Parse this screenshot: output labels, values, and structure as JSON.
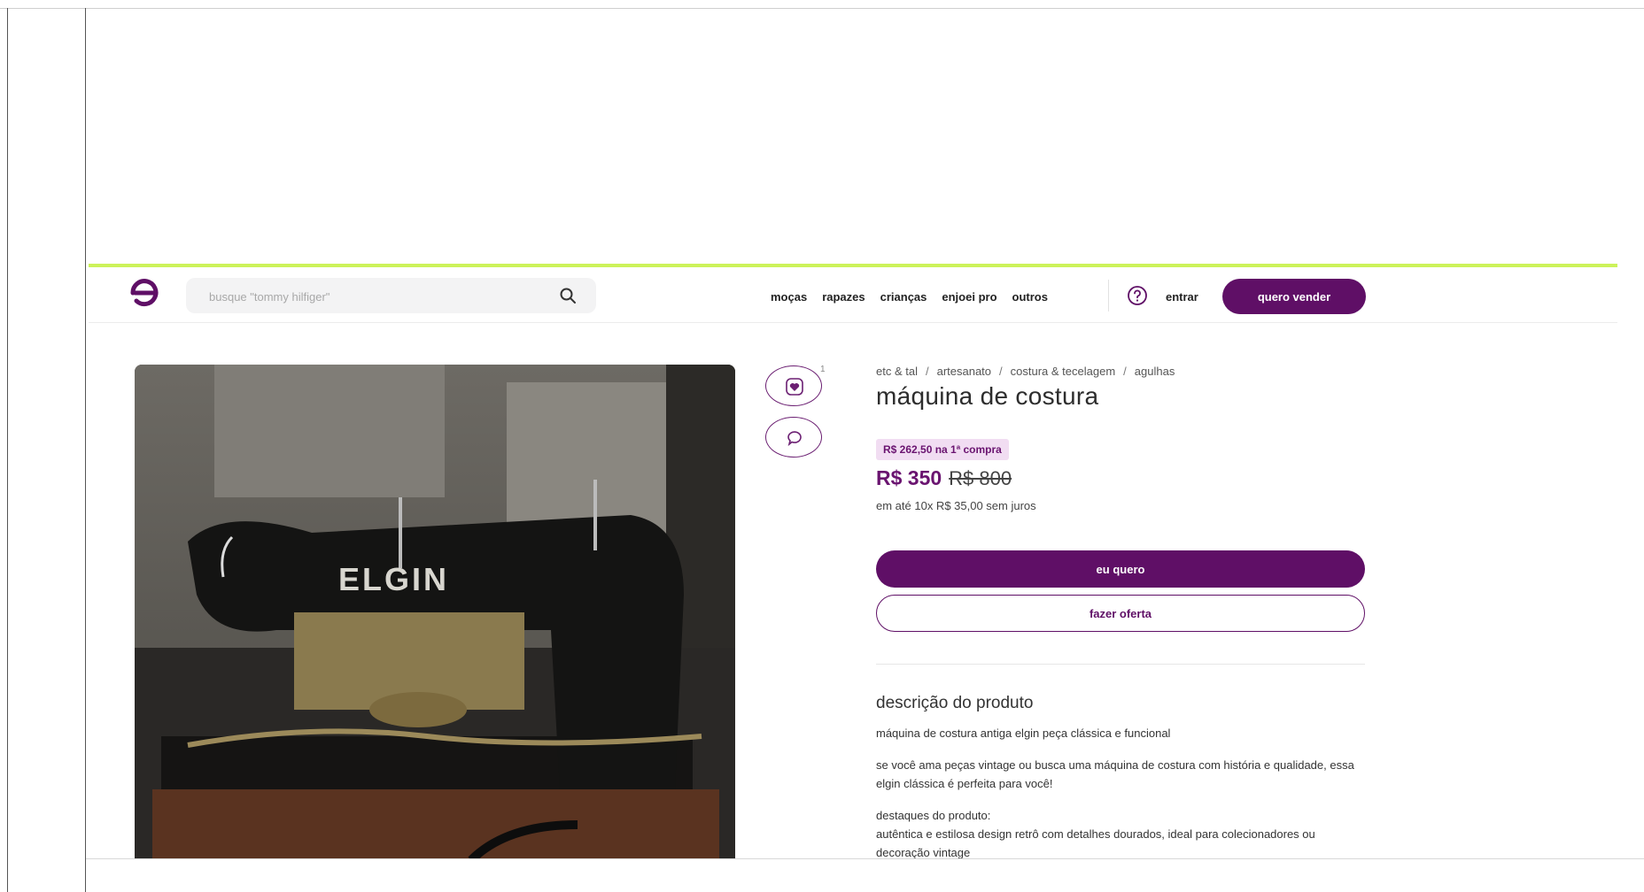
{
  "header": {
    "search_placeholder": "busque \"tommy hilfiger\"",
    "nav": [
      "moças",
      "rapazes",
      "crianças",
      "enjoei pro",
      "outros"
    ],
    "login_label": "entrar",
    "sell_label": "quero vender"
  },
  "product": {
    "breadcrumb": [
      "etc & tal",
      "artesanato",
      "costura & tecelagem",
      "agulhas"
    ],
    "title": "máquina de costura",
    "promo": "R$ 262,50 na 1ª compra",
    "price": "R$ 350",
    "old_price": "R$ 800",
    "installments": "em até 10x R$ 35,00 sem juros",
    "favorites_count": "1",
    "buy_label": "eu quero",
    "offer_label": "fazer oferta",
    "photo_label": "ELGIN"
  },
  "description": {
    "title": "descrição do produto",
    "p1": "máquina de costura antiga elgin peça clássica e funcional",
    "p2": "se você ama peças vintage ou busca uma máquina de costura com história e qualidade, essa elgin clássica é perfeita para você!",
    "p3_heading": "destaques do produto:",
    "p3_body": "autêntica e estilosa design retrô com detalhes dourados, ideal para colecionadores ou decoração vintage"
  },
  "colors": {
    "brand": "#5f0f66",
    "accent_line": "#ccf25a",
    "promo_bg": "#f1ddf2"
  },
  "icons": [
    "enjoei-logo-icon",
    "search-icon",
    "help-icon",
    "heart-icon",
    "chat-icon"
  ]
}
